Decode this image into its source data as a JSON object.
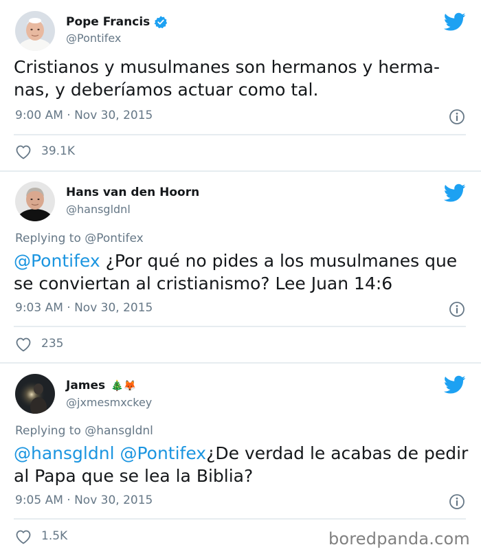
{
  "colors": {
    "twitter_blue": "#1da1f2",
    "mention": "#1b95e0",
    "secondary_text": "#657786",
    "divider": "#e6ecf0"
  },
  "tweets": [
    {
      "name": "Pope Francis",
      "handle": "@Pontifex",
      "verified": true,
      "text_line1": "Cristianos y musulmanes son hermanos y herma-",
      "text_line2": "nas, y deberíamos actuar como tal.",
      "timestamp": "9:00 AM · Nov 30, 2015",
      "likes": "39.1K",
      "avatar_icon": "pope-avatar"
    },
    {
      "name": "Hans van den Hoorn",
      "handle": "@hansgldnl",
      "replying_to": "Replying to @Pontifex",
      "mention1": "@Pontifex",
      "text_line1": " ¿Por qué no pides a los musulmanes que",
      "text_line2": "se conviertan al cristianismo? Lee Juan 14:6",
      "timestamp": "9:03 AM · Nov 30, 2015",
      "likes": "235",
      "avatar_icon": "man-avatar"
    },
    {
      "name": "James",
      "name_emoji": "🎄🦊",
      "handle": "@jxmesmxckey",
      "replying_to": "Replying to @hansgldnl",
      "mention1": "@hansgldnl",
      "mention2": "@Pontifex",
      "text_line1": "¿De verdad le acabas de pedir",
      "text_line2": "al Papa que se lea la Biblia?",
      "timestamp": "9:05 AM · Nov 30, 2015",
      "likes": "1.5K",
      "avatar_icon": "night-photo-avatar"
    }
  ],
  "watermark": "boredpanda.com"
}
